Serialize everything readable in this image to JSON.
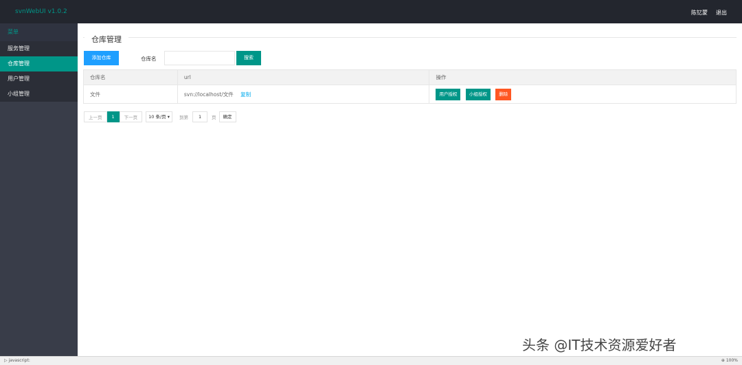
{
  "header": {
    "app_title": "svnWebUI v1.0.2",
    "user_name": "陈钇蒙",
    "logout": "退出"
  },
  "sidebar": {
    "title": "菜单",
    "items": [
      {
        "label": "服务管理",
        "active": false
      },
      {
        "label": "仓库管理",
        "active": true
      },
      {
        "label": "用户管理",
        "active": false
      },
      {
        "label": "小组管理",
        "active": false
      }
    ]
  },
  "main": {
    "title": "仓库管理",
    "add_button": "添加仓库",
    "search_label": "仓库名",
    "search_value": "",
    "search_button": "搜索",
    "table": {
      "headers": [
        "仓库名",
        "url",
        "操作"
      ],
      "rows": [
        {
          "name": "文件",
          "url": "svn://localhost/文件",
          "copy": "复制",
          "actions": [
            "用户授权",
            "小组授权",
            "删除"
          ]
        }
      ]
    },
    "pager": {
      "prev": "上一页",
      "current": "1",
      "next": "下一页",
      "page_size": "10 条/页",
      "goto_label": "到第",
      "goto_value": "1",
      "page_unit": "页",
      "confirm": "确定"
    }
  },
  "statusbar": {
    "left": "javascript:",
    "right": "100%"
  },
  "watermark": "头条 @IT技术资源爱好者",
  "colors": {
    "accent": "#009688",
    "blue": "#1e9fff",
    "danger": "#ff5722",
    "header_bg": "#23262e",
    "sidebar_bg": "#393d49"
  }
}
